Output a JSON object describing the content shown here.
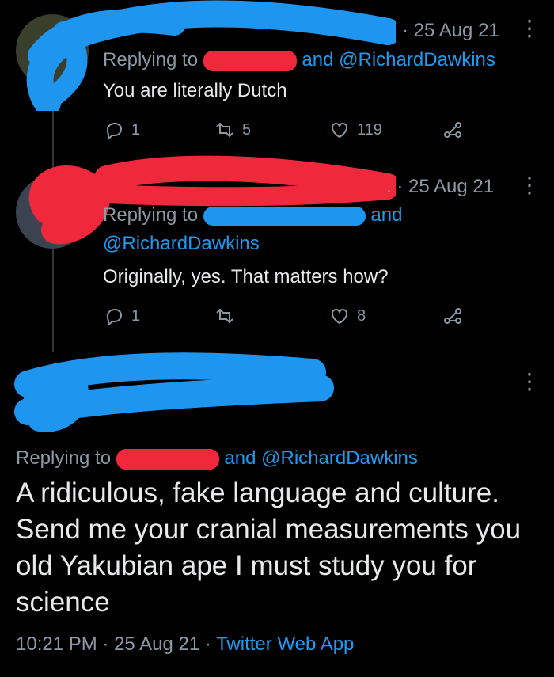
{
  "tweet1": {
    "date": "· 25 Aug 21",
    "replying_prefix": "Replying to",
    "replying_suffix": "and @RichardDawkins",
    "text": "You are literally Dutch",
    "replies": "1",
    "retweets": "5",
    "likes": "119"
  },
  "tweet2": {
    "date": ". · 25 Aug 21",
    "replying_prefix": "Replying to",
    "replying_and": "and",
    "replying_mention": "@RichardDawkins",
    "text": "Originally, yes. That matters how?",
    "replies": "1",
    "likes": "8"
  },
  "main": {
    "replying_prefix": "Replying to",
    "replying_suffix": "and @RichardDawkins",
    "text": "A ridiculous, fake language and culture. Send me your cranial measurements you old Yakubian ape I must study you for science",
    "time": "10:21 PM",
    "sep1": "·",
    "date": "25 Aug 21",
    "sep2": "·",
    "app": "Twitter Web App"
  },
  "icons": [
    "reply-icon",
    "retweet-icon",
    "like-icon",
    "share-icon",
    "more-icon"
  ],
  "colors": {
    "background": "#000000",
    "link": "#1d9bf0",
    "muted": "#8b98a5",
    "redaction_blue": "#1e96f0",
    "redaction_red": "#f0283c"
  }
}
